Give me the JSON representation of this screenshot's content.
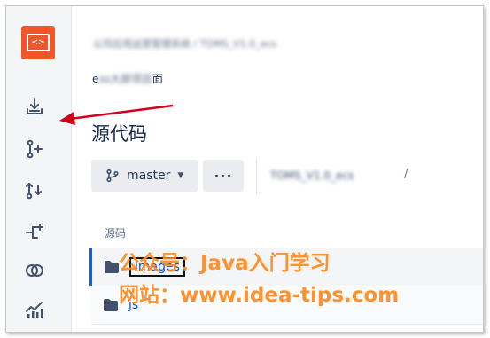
{
  "sidebar": {
    "logo": {
      "icon": "code-folder-icon",
      "glyph": "<>",
      "color": "#f1562a"
    },
    "items": [
      {
        "name": "download-icon"
      },
      {
        "name": "git-commit-icon"
      },
      {
        "name": "pull-request-icon"
      },
      {
        "name": "branch-icon"
      },
      {
        "name": "compare-icon"
      },
      {
        "name": "chart-icon"
      }
    ]
  },
  "header": {
    "breadcrumb": "公司应用运营管理系统 / TOMS_V1.0_ecs",
    "subtitle_prefix": "e",
    "subtitle_blurred": "ss大屏项目",
    "subtitle_suffix": "面"
  },
  "main": {
    "title": "源代码",
    "branch": {
      "label": "master",
      "icon": "branch-icon"
    },
    "more_label": "···",
    "path": "TOMS_V1.0_ecs",
    "path_separator": "/",
    "section_label": "源码",
    "files": [
      {
        "name": "images",
        "type": "folder",
        "selected": true
      },
      {
        "name": "js",
        "type": "folder",
        "selected": false
      }
    ]
  },
  "watermark": {
    "line1": "公众号：Java入门学习",
    "line2": "网站：www.idea-tips.com",
    "color": "#ff8a1f"
  },
  "annotation": {
    "arrow_color": "#d0021b"
  }
}
